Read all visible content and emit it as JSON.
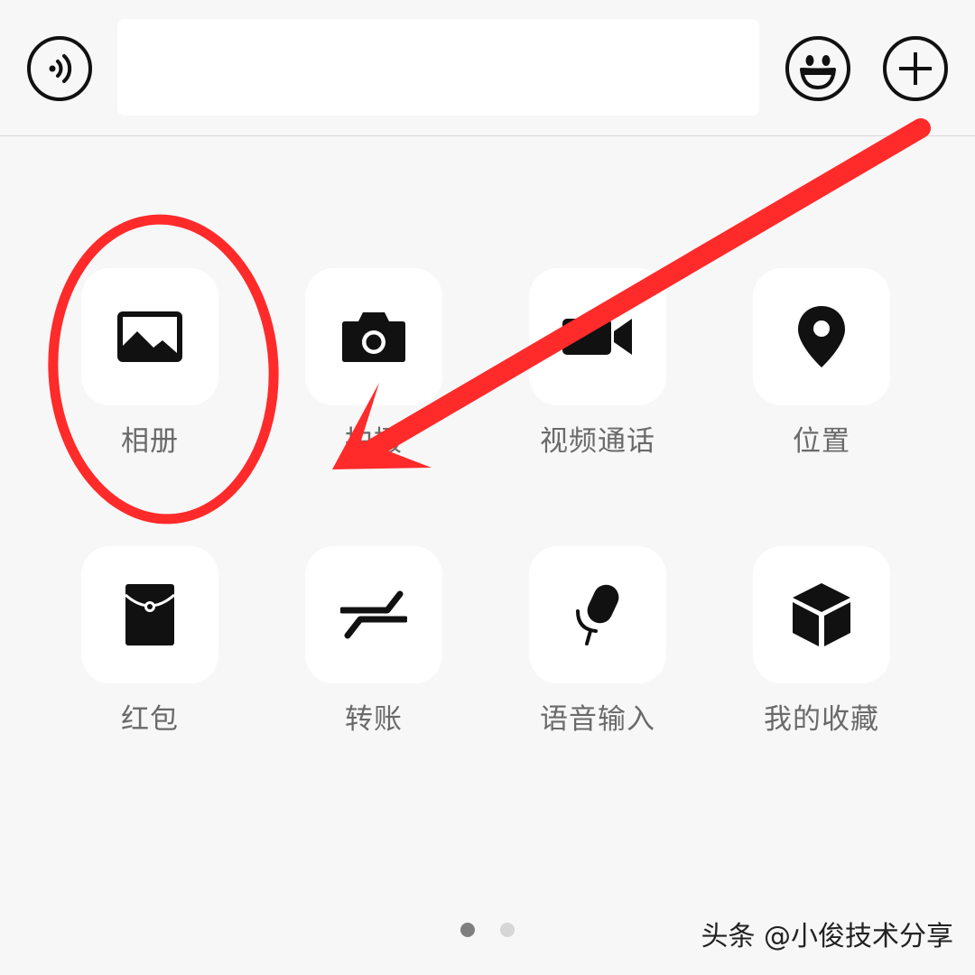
{
  "input_bar": {
    "voice_icon": "voice-input-icon",
    "text_value": "",
    "emoji_icon": "emoji-icon",
    "plus_icon": "plus-icon"
  },
  "panel": {
    "items": [
      {
        "label": "相册",
        "icon": "image-icon"
      },
      {
        "label": "拍摄",
        "icon": "camera-icon"
      },
      {
        "label": "视频通话",
        "icon": "video-call-icon"
      },
      {
        "label": "位置",
        "icon": "location-icon"
      },
      {
        "label": "红包",
        "icon": "red-packet-icon"
      },
      {
        "label": "转账",
        "icon": "transfer-icon"
      },
      {
        "label": "语音输入",
        "icon": "microphone-icon"
      },
      {
        "label": "我的收藏",
        "icon": "favorites-cube-icon"
      }
    ]
  },
  "pagination": {
    "current_page": 1,
    "total_pages": 2
  },
  "watermark": "头条 @小俊技术分享",
  "annotation": {
    "color": "#ff2a2a"
  }
}
